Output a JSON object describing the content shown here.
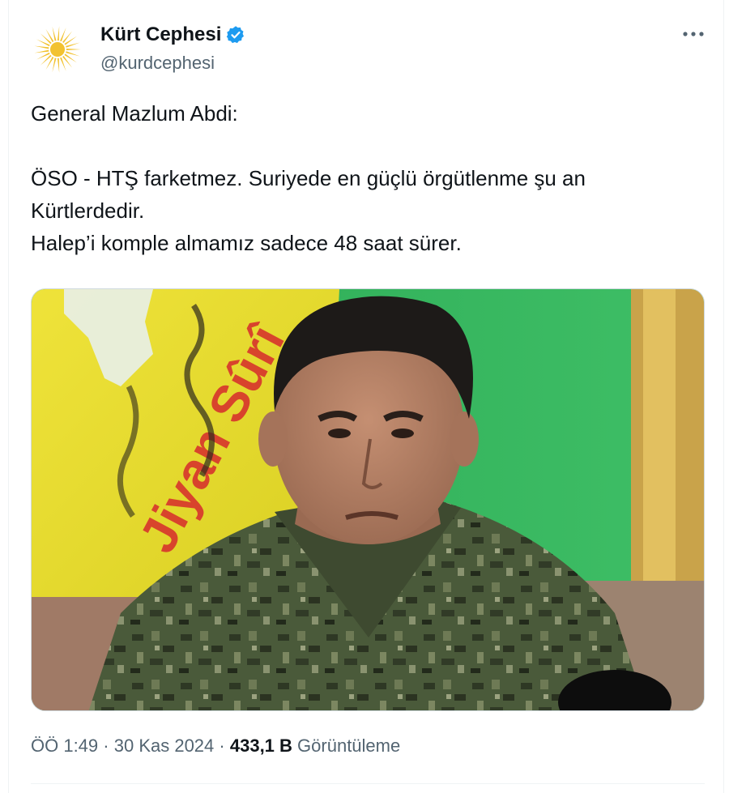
{
  "tweet": {
    "display_name": "Kürt Cephesi",
    "handle": "@kurdcephesi",
    "text_lines": [
      "General Mazlum Abdi:",
      "",
      "ÖSO - HTŞ farketmez. Suriyede en güçlü örgütlenme şu an",
      "Kürtlerdedir.",
      "Halep’i komple almamız sadece 48 saat sürer."
    ],
    "time": "ÖÖ 1:49",
    "separator": "·",
    "date": "30 Kas 2024",
    "views_count": "433,1 B",
    "views_label": "Görüntüleme",
    "media_flag_text": "Jiyan Sûrî"
  },
  "icons": {
    "avatar": "sun-emblem-icon",
    "verified": "verified-badge-icon",
    "more": "more-horizontal-icon"
  },
  "colors": {
    "text_primary": "#0f1419",
    "text_secondary": "#536471",
    "verified_blue": "#1d9bf0",
    "avatar_sun": "#f2c230",
    "flag_yellow": "#e8df2c",
    "flag_green": "#2fae57",
    "flag_red": "#d8442c"
  }
}
